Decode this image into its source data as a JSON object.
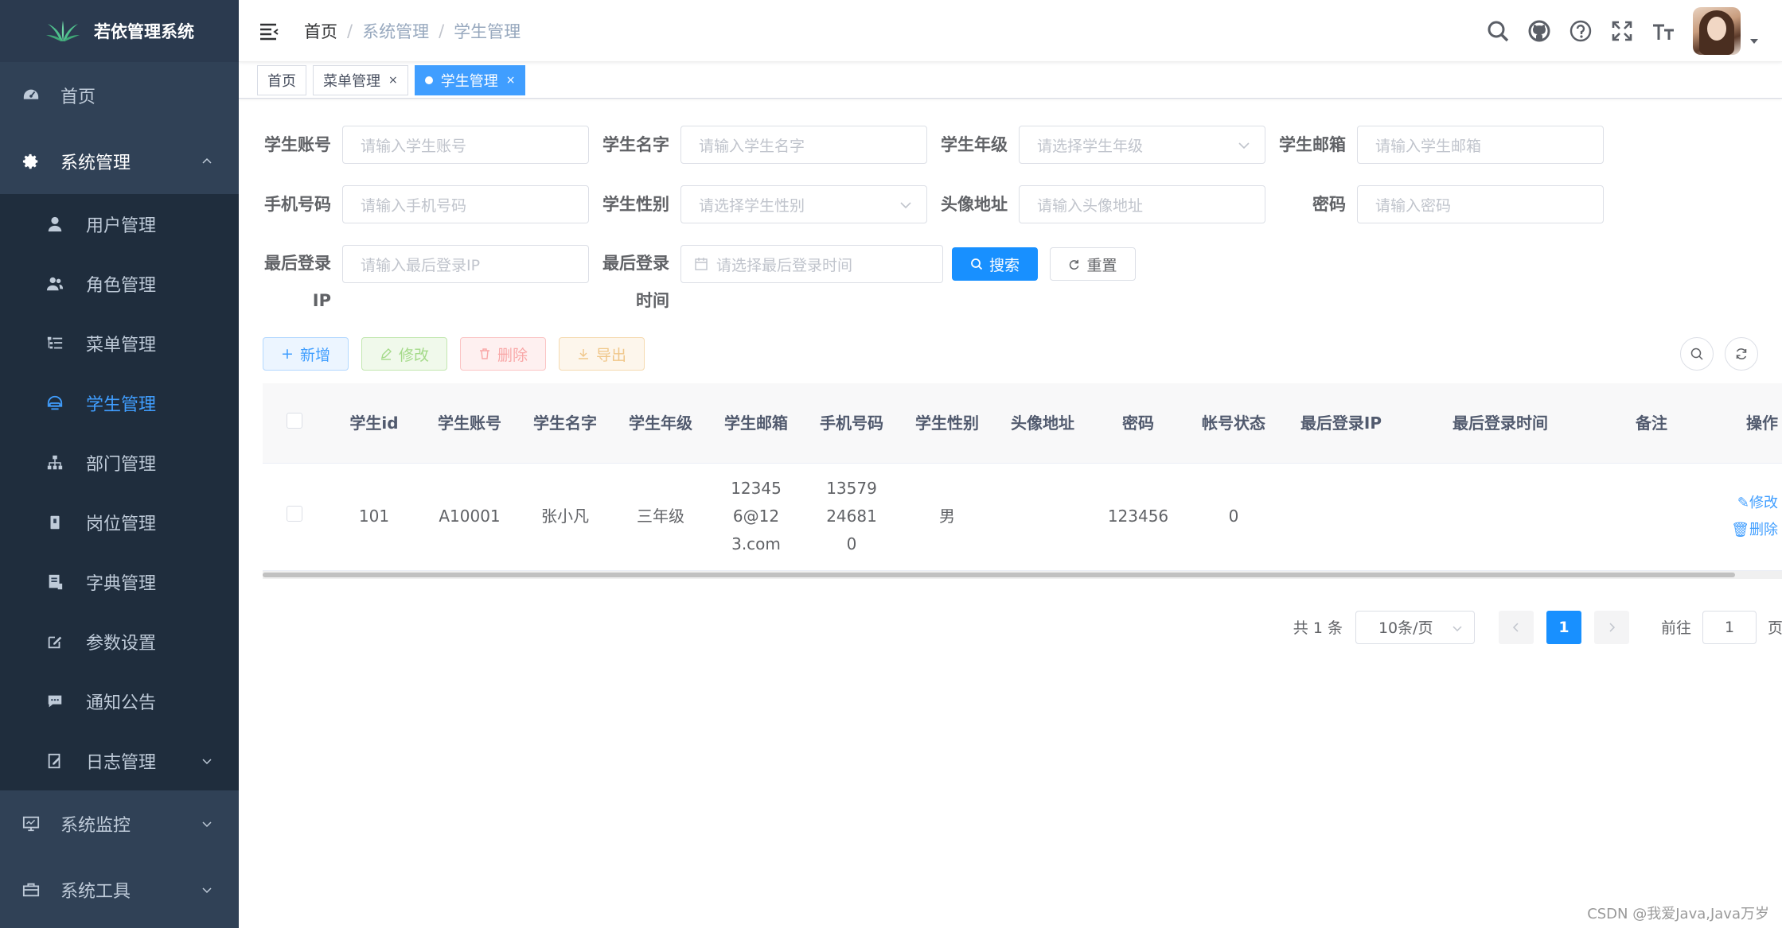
{
  "sidebar": {
    "title": "若依管理系统",
    "home": "首页",
    "system": "系统管理",
    "items": [
      {
        "label": "用户管理",
        "icon": "user-icon"
      },
      {
        "label": "角色管理",
        "icon": "peoples-icon"
      },
      {
        "label": "菜单管理",
        "icon": "tree-table-icon"
      },
      {
        "label": "学生管理",
        "icon": "student-icon"
      },
      {
        "label": "部门管理",
        "icon": "tree-icon"
      },
      {
        "label": "岗位管理",
        "icon": "post-icon"
      },
      {
        "label": "字典管理",
        "icon": "dict-icon"
      },
      {
        "label": "参数设置",
        "icon": "edit-icon"
      },
      {
        "label": "通知公告",
        "icon": "message-icon"
      },
      {
        "label": "日志管理",
        "icon": "log-icon"
      }
    ],
    "monitor": "系统监控",
    "tool": "系统工具"
  },
  "navbar": {
    "breadcrumb": [
      "首页",
      "系统管理",
      "学生管理"
    ]
  },
  "tags": [
    {
      "label": "首页"
    },
    {
      "label": "菜单管理",
      "close": "×"
    },
    {
      "label": "学生管理",
      "close": "×"
    }
  ],
  "form": {
    "account_label": "学生账号",
    "account_ph": "请输入学生账号",
    "name_label": "学生名字",
    "name_ph": "请输入学生名字",
    "grade_label": "学生年级",
    "grade_ph": "请选择学生年级",
    "email_label": "学生邮箱",
    "email_ph": "请输入学生邮箱",
    "phone_label": "手机号码",
    "phone_ph": "请输入手机号码",
    "gender_label": "学生性别",
    "gender_ph": "请选择学生性别",
    "avatar_label": "头像地址",
    "avatar_ph": "请输入头像地址",
    "pwd_label": "密码",
    "pwd_ph": "请输入密码",
    "ip_label_1": "最后登录",
    "ip_label_2": "IP",
    "ip_ph": "请输入最后登录IP",
    "time_label_1": "最后登录",
    "time_label_2": "时间",
    "time_ph": "请选择最后登录时间",
    "search": "搜索",
    "reset": "重置"
  },
  "toolbar": {
    "add": "新增",
    "edit": "修改",
    "delete": "删除",
    "export": "导出"
  },
  "table": {
    "headers": [
      "学生id",
      "学生账号",
      "学生名字",
      "学生年级",
      "学生邮箱",
      "手机号码",
      "学生性别",
      "头像地址",
      "密码",
      "帐号状态",
      "最后登录IP",
      "最后登录时间",
      "备注",
      "操作"
    ],
    "rows": [
      {
        "id": "101",
        "account": "A10001",
        "name": "张小凡",
        "grade": "三年级",
        "email": "123456@123.com",
        "phone": "13579246810",
        "gender": "男",
        "avatar": "",
        "password": "123456",
        "status": "0",
        "last_ip": "",
        "last_time": "",
        "remark": "",
        "op_edit": "修改",
        "op_delete": "删除"
      }
    ]
  },
  "pagination": {
    "total": "共 1 条",
    "page_size": "10条/页",
    "current": "1",
    "goto_label": "前往",
    "goto_value": "1",
    "page_suffix": "页"
  },
  "watermark": "CSDN @我爱Java,Java万岁",
  "colors": {
    "sidebar_bg": "#304156",
    "submenu_bg": "#1f2d3d",
    "primary": "#1890ff",
    "active_menu": "#409eff"
  }
}
